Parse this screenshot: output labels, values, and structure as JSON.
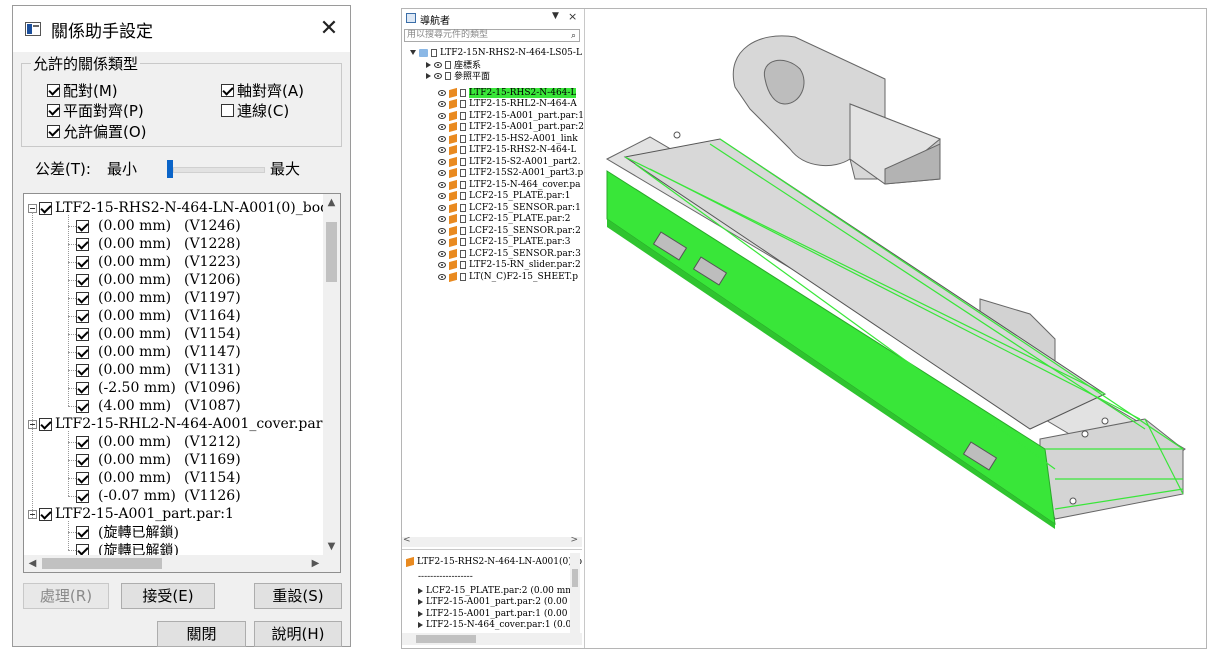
{
  "dialog": {
    "title": "關係助手設定",
    "close_glyph": "✕",
    "group_title": "允許的關係類型",
    "options": [
      {
        "label": "配對(M)",
        "checked": true
      },
      {
        "label": "軸對齊(A)",
        "checked": true
      },
      {
        "label": "平面對齊(P)",
        "checked": true
      },
      {
        "label": "連線(C)",
        "checked": false
      },
      {
        "label": "允許偏置(O)",
        "checked": true
      }
    ],
    "tolerance": {
      "label": "公差(T):",
      "min_label": "最小",
      "max_label": "最大",
      "level": 0.05
    },
    "tree": [
      {
        "type": "parent",
        "label": "LTF2-15-RHS2-N-464-LN-A001(0)_boc"
      },
      {
        "type": "child",
        "value": "(0.00 mm)",
        "ref": "(V1246)"
      },
      {
        "type": "child",
        "value": "(0.00 mm)",
        "ref": "(V1228)"
      },
      {
        "type": "child",
        "value": "(0.00 mm)",
        "ref": "(V1223)"
      },
      {
        "type": "child",
        "value": "(0.00 mm)",
        "ref": "(V1206)"
      },
      {
        "type": "child",
        "value": "(0.00 mm)",
        "ref": "(V1197)"
      },
      {
        "type": "child",
        "value": "(0.00 mm)",
        "ref": "(V1164)"
      },
      {
        "type": "child",
        "value": "(0.00 mm)",
        "ref": "(V1154)"
      },
      {
        "type": "child",
        "value": "(0.00 mm)",
        "ref": "(V1147)"
      },
      {
        "type": "child",
        "value": "(0.00 mm)",
        "ref": "(V1131)"
      },
      {
        "type": "child",
        "value": "(-2.50 mm)",
        "ref": "(V1096)"
      },
      {
        "type": "child",
        "value": "(4.00 mm)",
        "ref": "(V1087)"
      },
      {
        "type": "parent",
        "label": "LTF2-15-RHL2-N-464-A001_cover.par:"
      },
      {
        "type": "child",
        "value": "(0.00 mm)",
        "ref": "(V1212)"
      },
      {
        "type": "child",
        "value": "(0.00 mm)",
        "ref": "(V1169)"
      },
      {
        "type": "child",
        "value": "(0.00 mm)",
        "ref": "(V1154)"
      },
      {
        "type": "child",
        "value": "(-0.07 mm)",
        "ref": "(V1126)"
      },
      {
        "type": "parent",
        "label": "LTF2-15-A001_part.par:1"
      },
      {
        "type": "child",
        "value": "(旋轉已解鎖)",
        "ref": ""
      },
      {
        "type": "child",
        "value": "(旋轉已解鎖)",
        "ref": ""
      }
    ],
    "buttons": {
      "process": "處理(R)",
      "accept": "接受(E)",
      "reset": "重設(S)",
      "close": "關閉",
      "help": "說明(H)"
    }
  },
  "navigator": {
    "title": "導航者",
    "pin_glyph": "▼",
    "close_glyph": "×",
    "search_placeholder": "用以搜尋元件的類型",
    "root": "LTF2-15N-RHS2-N-464-LS05-L",
    "folders": [
      "座標系",
      "參照平面"
    ],
    "items": [
      "LTF2-15-RHS2-N-464-L",
      "LTF2-15-RHL2-N-464-A",
      "LTF2-15-A001_part.par:1",
      "LTF2-15-A001_part.par:2",
      "LTF2-15-HS2-A001_link",
      "LTF2-15-RHS2-N-464-L",
      "LTF2-15-S2-A001_part2.",
      "LTF2-15S2-A001_part3.p",
      "LTF2-15-N-464_cover.pa",
      "LCF2-15_PLATE.par:1",
      "LCF2-15_SENSOR.par:1",
      "LCF2-15_PLATE.par:2",
      "LCF2-15_SENSOR.par:2",
      "LCF2-15_PLATE.par:3",
      "LCF2-15_SENSOR.par:3",
      "LTF2-15-RN_slider.par:2",
      "LT(N_C)F2-15_SHEET.p"
    ],
    "lower_header": "LTF2-15-RHS2-N-464-LN-A001(0)_b",
    "lower_sep": "------------------",
    "lower_items": [
      "LCF2-15_PLATE.par:2  (0.00 mm",
      "LTF2-15-A001_part.par:2  (0.00 n",
      "LTF2-15-A001_part.par:1  (0.00 n",
      "LTF2-15-N-464_cover.par:1  (0.0"
    ]
  },
  "colors": {
    "highlight": "#39e639",
    "model_gray": "#cfcfcf",
    "dialog_bg": "#f0f0f0"
  }
}
